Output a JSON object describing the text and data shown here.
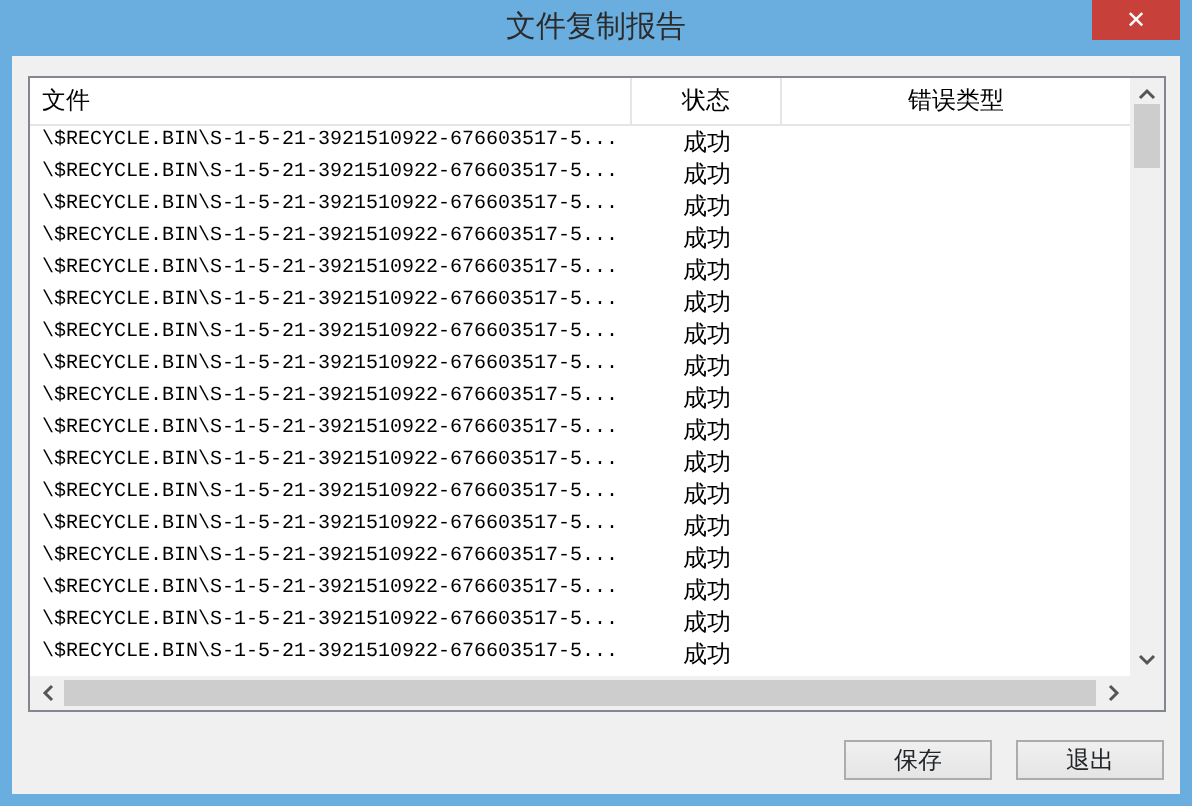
{
  "window": {
    "title": "文件复制报告",
    "close": "✕"
  },
  "table": {
    "columns": [
      "文件",
      "状态",
      "错误类型"
    ],
    "rows": [
      {
        "file": "\\$RECYCLE.BIN\\S-1-5-21-3921510922-676603517-5...",
        "status": "成功"
      },
      {
        "file": "\\$RECYCLE.BIN\\S-1-5-21-3921510922-676603517-5...",
        "status": "成功"
      },
      {
        "file": "\\$RECYCLE.BIN\\S-1-5-21-3921510922-676603517-5...",
        "status": "成功"
      },
      {
        "file": "\\$RECYCLE.BIN\\S-1-5-21-3921510922-676603517-5...",
        "status": "成功"
      },
      {
        "file": "\\$RECYCLE.BIN\\S-1-5-21-3921510922-676603517-5...",
        "status": "成功"
      },
      {
        "file": "\\$RECYCLE.BIN\\S-1-5-21-3921510922-676603517-5...",
        "status": "成功"
      },
      {
        "file": "\\$RECYCLE.BIN\\S-1-5-21-3921510922-676603517-5...",
        "status": "成功"
      },
      {
        "file": "\\$RECYCLE.BIN\\S-1-5-21-3921510922-676603517-5...",
        "status": "成功"
      },
      {
        "file": "\\$RECYCLE.BIN\\S-1-5-21-3921510922-676603517-5...",
        "status": "成功"
      },
      {
        "file": "\\$RECYCLE.BIN\\S-1-5-21-3921510922-676603517-5...",
        "status": "成功"
      },
      {
        "file": "\\$RECYCLE.BIN\\S-1-5-21-3921510922-676603517-5...",
        "status": "成功"
      },
      {
        "file": "\\$RECYCLE.BIN\\S-1-5-21-3921510922-676603517-5...",
        "status": "成功"
      },
      {
        "file": "\\$RECYCLE.BIN\\S-1-5-21-3921510922-676603517-5...",
        "status": "成功"
      },
      {
        "file": "\\$RECYCLE.BIN\\S-1-5-21-3921510922-676603517-5...",
        "status": "成功"
      },
      {
        "file": "\\$RECYCLE.BIN\\S-1-5-21-3921510922-676603517-5...",
        "status": "成功"
      },
      {
        "file": "\\$RECYCLE.BIN\\S-1-5-21-3921510922-676603517-5...",
        "status": "成功"
      },
      {
        "file": "\\$RECYCLE.BIN\\S-1-5-21-3921510922-676603517-5...",
        "status": "成功"
      }
    ]
  },
  "buttons": [
    "保存",
    "退出"
  ]
}
